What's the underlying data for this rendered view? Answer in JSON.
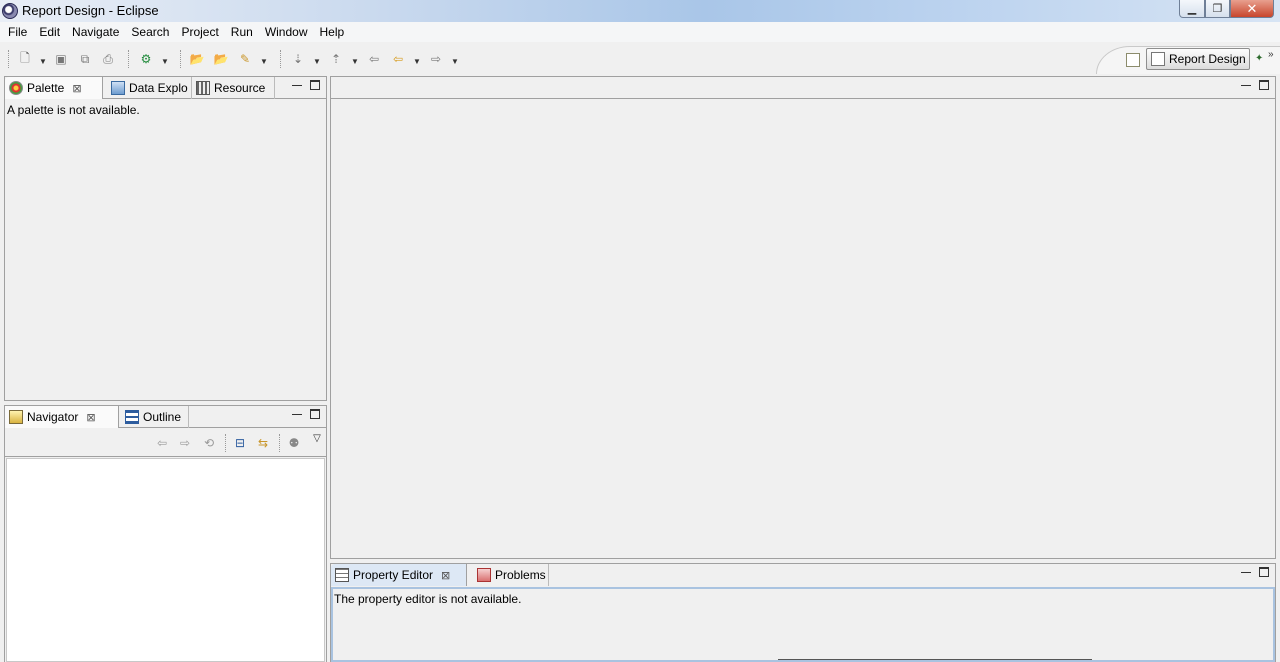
{
  "window": {
    "title": "Report Design - Eclipse",
    "controls": {
      "minimize": "minimize-icon",
      "maximize": "maximize-icon",
      "close": "close-icon"
    }
  },
  "menubar": {
    "items": [
      "File",
      "Edit",
      "Navigate",
      "Search",
      "Project",
      "Run",
      "Window",
      "Help"
    ]
  },
  "toolbar": {
    "buttons": [
      "new-icon",
      "save-icon",
      "save-all-icon",
      "print-icon",
      "run-icon",
      "open-folder-icon",
      "open-file-icon",
      "pencil-icon",
      "next-annotation-icon",
      "previous-annotation-icon",
      "last-edit-icon",
      "back-icon",
      "forward-icon"
    ]
  },
  "perspective": {
    "label": "Report Design",
    "more": "»"
  },
  "palette_panel": {
    "tabs": [
      "Palette",
      "Data Explo",
      "Resource"
    ],
    "message": "A palette is not available."
  },
  "navigator_panel": {
    "tabs": [
      "Navigator",
      "Outline"
    ]
  },
  "property_panel": {
    "tabs": [
      "Property Editor",
      "Problems"
    ],
    "message": "The property editor is not available."
  },
  "colors": {
    "titlebar_accent": "#a9c6e8",
    "panel_border": "#a0a0a0",
    "focus_border": "#a9c3e0",
    "background": "#f0f0f0"
  }
}
